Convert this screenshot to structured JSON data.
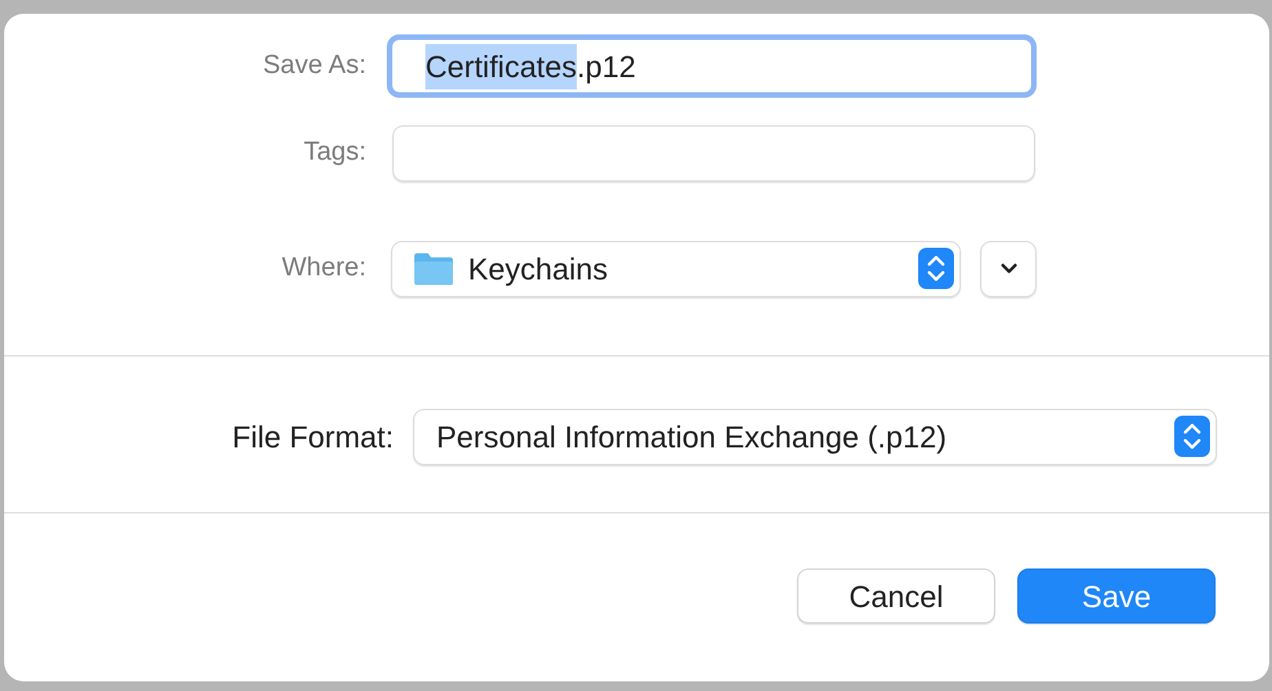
{
  "save_as": {
    "label": "Save As:",
    "value_selected": "Certificates",
    "value_rest": ".p12",
    "focused": true
  },
  "tags": {
    "label": "Tags:"
  },
  "where": {
    "label": "Where:",
    "value": "Keychains"
  },
  "file_format": {
    "label": "File Format:",
    "value": "Personal Information Exchange (.p12)"
  },
  "buttons": [
    {
      "label": "Cancel",
      "kind": "secondary"
    },
    {
      "label": "Save",
      "kind": "primary"
    }
  ]
}
